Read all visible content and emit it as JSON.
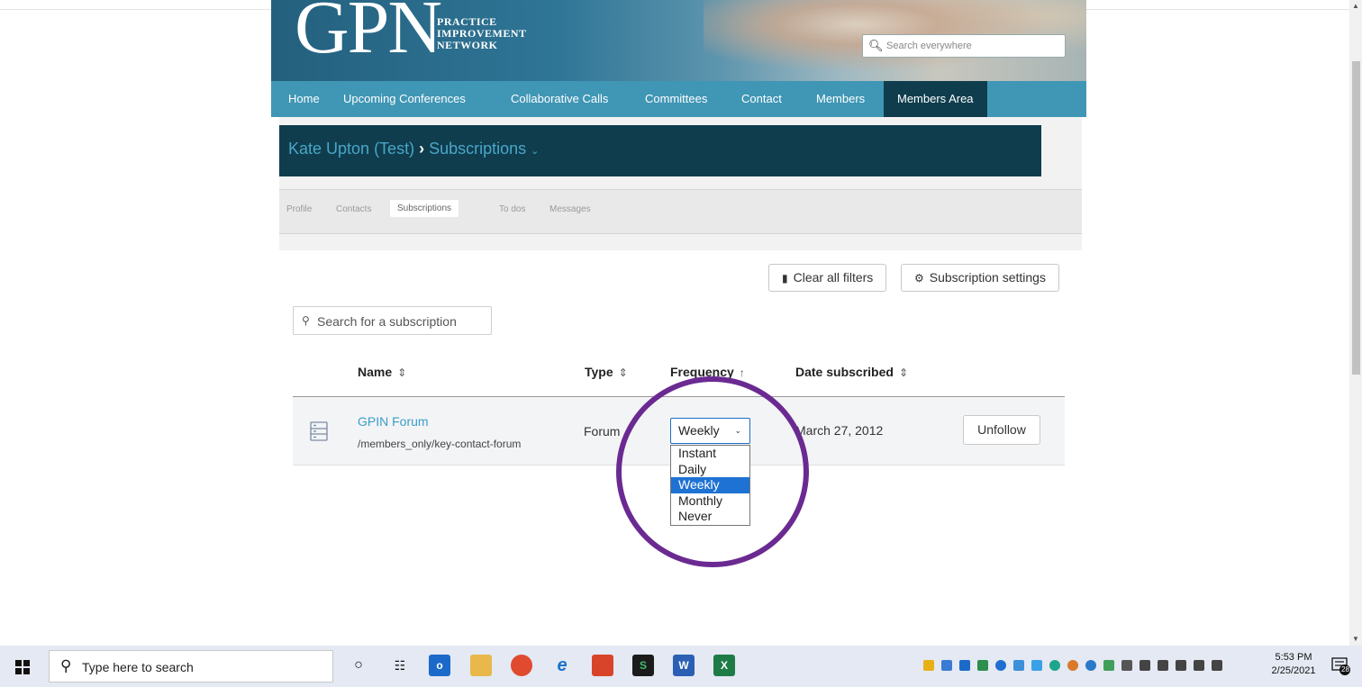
{
  "banner": {
    "logo": "GPN",
    "subtitle_lines": [
      "PRACTICE",
      "IMPROVEMENT",
      "NETWORK"
    ],
    "search_placeholder": "Search everywhere"
  },
  "nav": {
    "items": [
      "Home",
      "Upcoming Conferences",
      "Collaborative Calls",
      "Committees",
      "Contact",
      "Members",
      "Members Area"
    ],
    "active": "Members Area"
  },
  "profile": {
    "user": "Kate Upton (Test)",
    "separator": "›",
    "section": "Subscriptions",
    "caret": "⌄",
    "tabs": [
      "Profile",
      "Contacts",
      "Subscriptions",
      "To dos",
      "Messages"
    ],
    "active_tab": "Subscriptions"
  },
  "toolbar": {
    "clear_filters": "Clear all filters",
    "subscription_settings": "Subscription settings"
  },
  "subscription_search": {
    "placeholder": "Search for a subscription"
  },
  "table": {
    "columns": [
      {
        "label": "Name",
        "sort": "⇕"
      },
      {
        "label": "Type",
        "sort": "⇕"
      },
      {
        "label": "Frequency",
        "sort": "↑"
      },
      {
        "label": "Date subscribed",
        "sort": "⇕"
      }
    ],
    "rows": [
      {
        "name": "GPIN Forum",
        "path": "/members_only/key-contact-forum",
        "type": "Forum",
        "frequency": "Weekly",
        "date": "March 27, 2012",
        "action": "Unfollow"
      }
    ]
  },
  "frequency_dropdown": {
    "selected": "Weekly",
    "options": [
      "Instant",
      "Daily",
      "Weekly",
      "Monthly",
      "Never"
    ]
  },
  "annotation": {
    "color": "#6b2a91"
  },
  "taskbar": {
    "search_placeholder": "Type here to search",
    "time": "5:53 PM",
    "date": "2/25/2021",
    "notification_count": "28"
  },
  "colors": {
    "nav": "#4096b5",
    "title_bar": "#0f3d4e",
    "link": "#3a9ec7",
    "selected_option": "#1e72d3"
  }
}
